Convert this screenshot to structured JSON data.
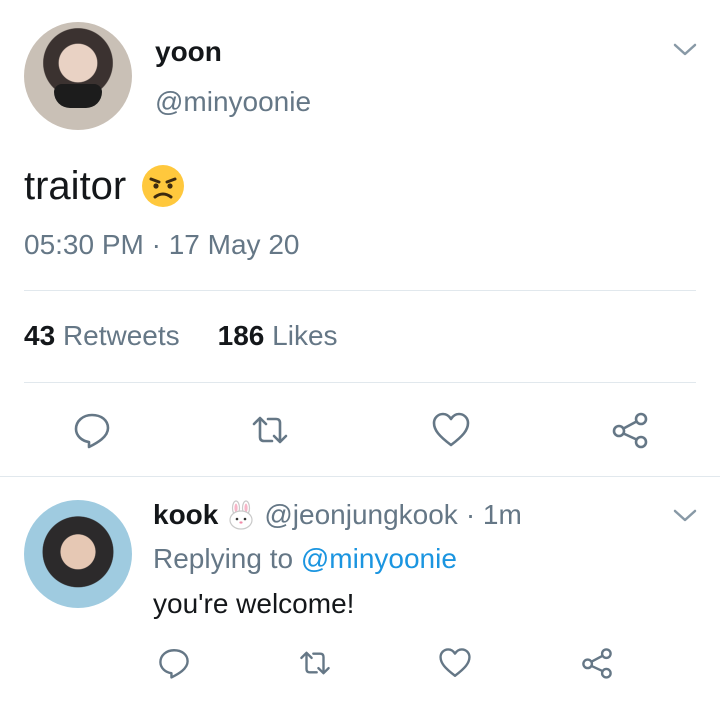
{
  "main_tweet": {
    "name": "yoon",
    "handle": "@minyoonie",
    "text": "traitor",
    "emoji": "angry-face",
    "timestamp": "05:30 PM · 17 May 20",
    "retweets_count": "43",
    "retweets_label": "Retweets",
    "likes_count": "186",
    "likes_label": "Likes"
  },
  "reply_tweet": {
    "name": "kook",
    "name_emoji": "rabbit-face",
    "handle": "@jeonjungkook",
    "time": "· 1m",
    "replying_prefix": "Replying to",
    "replying_to": "@minyoonie",
    "text": "you're welcome!"
  },
  "icons": [
    "reply-icon",
    "retweet-icon",
    "like-icon",
    "share-icon",
    "chevron-down-icon"
  ],
  "colors": {
    "text": "#14171a",
    "secondary": "#657786",
    "link": "#1b95e0",
    "divider": "#e1e8ed"
  }
}
